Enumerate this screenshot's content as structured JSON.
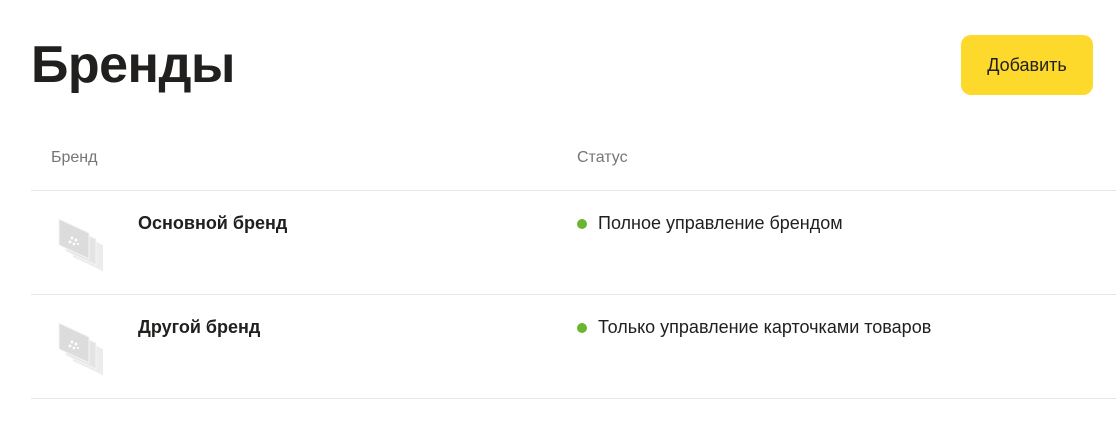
{
  "page": {
    "title": "Бренды",
    "add_button_label": "Добавить"
  },
  "table": {
    "columns": {
      "brand": "Бренд",
      "status": "Статус"
    },
    "rows": [
      {
        "logo_icon": "brand-placeholder-icon",
        "name": "Основной бренд",
        "status": "Полное управление брендом",
        "status_color": "#6bb52f"
      },
      {
        "logo_icon": "brand-placeholder-icon",
        "name": "Другой бренд",
        "status": "Только управление карточками товаров",
        "status_color": "#6bb52f"
      }
    ]
  },
  "colors": {
    "accent": "#fcd92b",
    "text": "#21201f",
    "muted": "#757575",
    "divider": "#e6e6e6"
  }
}
